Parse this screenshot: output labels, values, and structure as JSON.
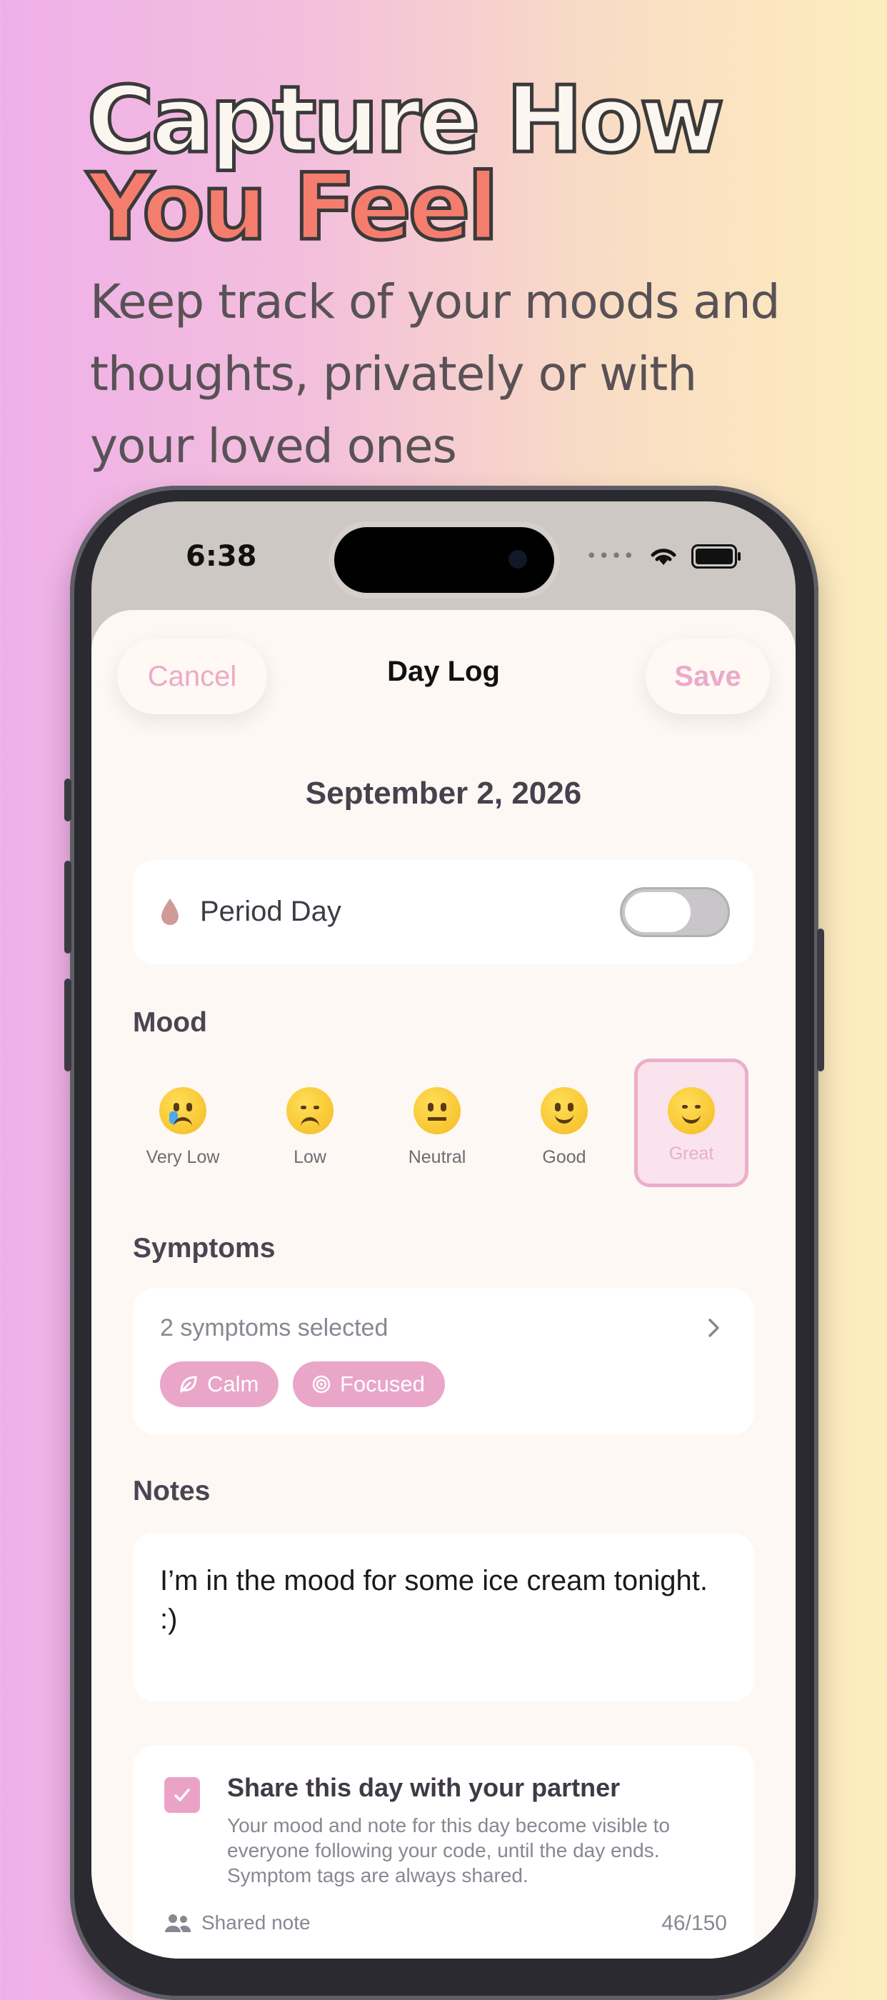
{
  "headline": {
    "line1": "Capture How",
    "line2": "You Feel",
    "subtitle": "Keep track of your moods and thoughts, privately or with your loved ones"
  },
  "status_bar": {
    "time": "6:38"
  },
  "nav": {
    "cancel": "Cancel",
    "title": "Day Log",
    "save": "Save"
  },
  "date": "September 2, 2026",
  "period": {
    "label": "Period Day",
    "enabled": false
  },
  "mood": {
    "section_label": "Mood",
    "options": [
      {
        "label": "Very Low",
        "selected": false
      },
      {
        "label": "Low",
        "selected": false
      },
      {
        "label": "Neutral",
        "selected": false
      },
      {
        "label": "Good",
        "selected": false
      },
      {
        "label": "Great",
        "selected": true
      }
    ]
  },
  "symptoms": {
    "section_label": "Symptoms",
    "count_text": "2 symptoms selected",
    "chips": [
      {
        "label": "Calm",
        "icon": "leaf-icon"
      },
      {
        "label": "Focused",
        "icon": "target-icon"
      }
    ]
  },
  "notes": {
    "section_label": "Notes",
    "text": "I’m in the mood for some ice cream tonight. :)"
  },
  "share": {
    "checked": true,
    "title": "Share this day with your partner",
    "description": "Your mood and note for this day become visible to everyone following your code, until the day ends. Symptom tags are always shared.",
    "shared_note_label": "Shared note",
    "counter": "46/150"
  },
  "colors": {
    "accent": "#EAA3C6",
    "headline_coral": "#F47D6E",
    "sheet_bg": "#FDF8F4"
  }
}
